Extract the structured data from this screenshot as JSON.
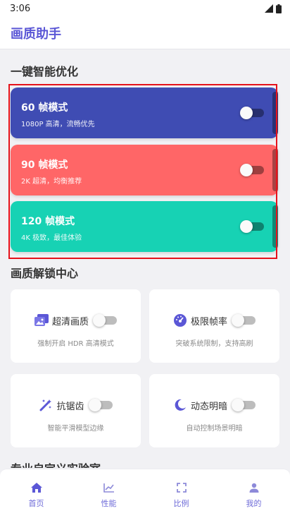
{
  "status_bar": {
    "time": "3:06"
  },
  "app_bar": {
    "title": "画质助手"
  },
  "quick_section": {
    "title": "一键智能优化",
    "modes": [
      {
        "name": "60 帧模式",
        "desc": "1080P 高清，流畅优先",
        "color": "#3f4cb3",
        "enabled": false
      },
      {
        "name": "90 帧模式",
        "desc": "2K 超清，均衡推荐",
        "color": "#ff6667",
        "enabled": false
      },
      {
        "name": "120 帧模式",
        "desc": "4K 极致，最佳体验",
        "color": "#17d2b4",
        "enabled": false
      }
    ]
  },
  "unlock_section": {
    "title": "画质解锁中心",
    "features": [
      {
        "name": "超清画质",
        "desc": "强制开启 HDR 高清模式",
        "icon": "image-icon",
        "enabled": false
      },
      {
        "name": "极限帧率",
        "desc": "突破系统限制，支持高刷",
        "icon": "speedometer-icon",
        "enabled": false
      },
      {
        "name": "抗锯齿",
        "desc": "智能平滑模型边缘",
        "icon": "magic-wand-icon",
        "enabled": false
      },
      {
        "name": "动态明暗",
        "desc": "自动控制场景明暗",
        "icon": "moon-icon",
        "enabled": false
      }
    ]
  },
  "lab_section": {
    "title": "专业自定义实验室"
  },
  "bottom_nav": {
    "items": [
      {
        "label": "首页",
        "icon": "home-icon",
        "active": true
      },
      {
        "label": "性能",
        "icon": "chart-icon",
        "active": false
      },
      {
        "label": "比例",
        "icon": "fullscreen-icon",
        "active": false
      },
      {
        "label": "我的",
        "icon": "person-icon",
        "active": false
      }
    ]
  },
  "colors": {
    "accent": "#5b57d6",
    "highlight": "#e5121b"
  }
}
